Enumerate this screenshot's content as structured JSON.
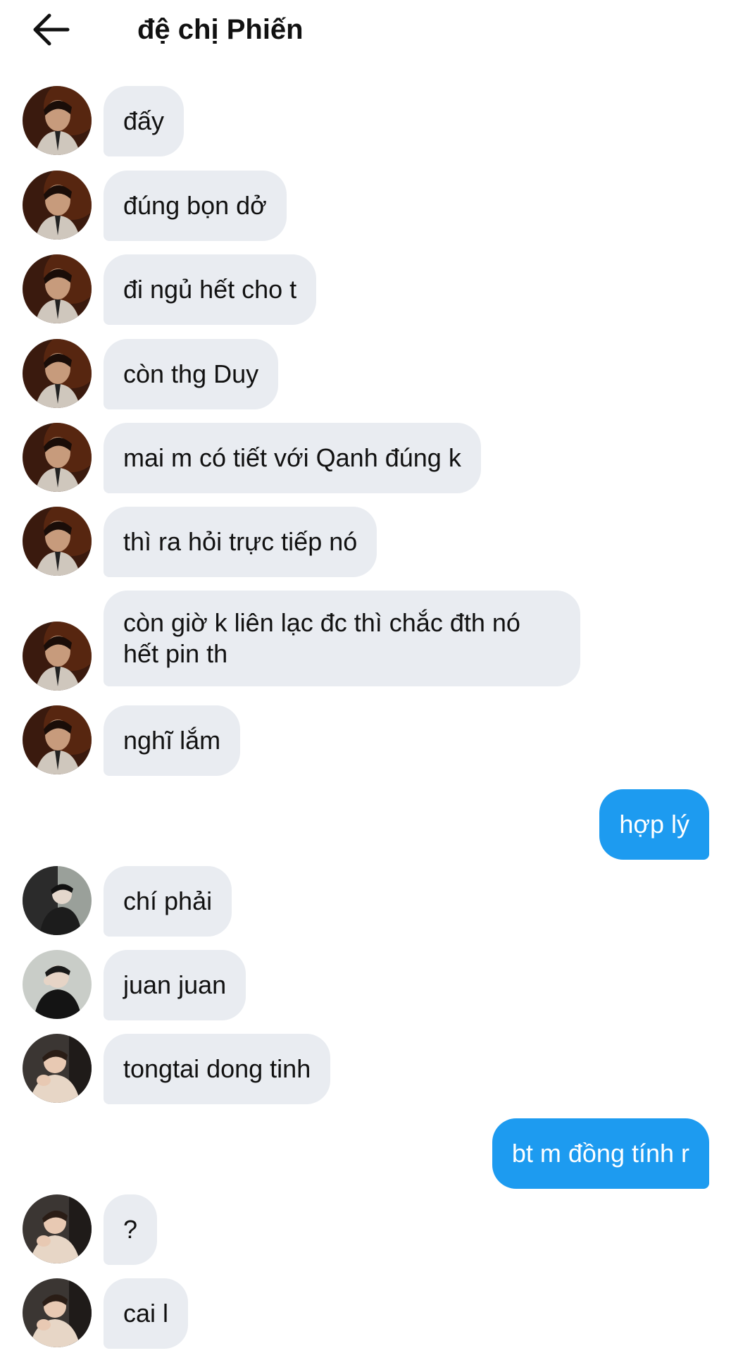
{
  "header": {
    "title": "đệ chị Phiến",
    "back_icon": "arrow-left-icon"
  },
  "colors": {
    "incoming_bubble": "#e9ecf1",
    "outgoing_bubble": "#1d9bf0",
    "background": "#ffffff"
  },
  "messages": [
    {
      "direction": "incoming",
      "avatar": "avatar-dark-portrait",
      "text": "đấy"
    },
    {
      "direction": "incoming",
      "avatar": "avatar-dark-portrait",
      "text": "đúng bọn dở"
    },
    {
      "direction": "incoming",
      "avatar": "avatar-dark-portrait",
      "text": "đi ngủ hết cho t"
    },
    {
      "direction": "incoming",
      "avatar": "avatar-dark-portrait",
      "text": "còn thg Duy"
    },
    {
      "direction": "incoming",
      "avatar": "avatar-dark-portrait",
      "text": "mai m có tiết với Qanh đúng k"
    },
    {
      "direction": "incoming",
      "avatar": "avatar-dark-portrait",
      "text": "thì ra hỏi trực tiếp nó"
    },
    {
      "direction": "incoming",
      "avatar": "avatar-dark-portrait",
      "text": "còn giờ k liên lạc đc thì chắc đth nó hết pin th"
    },
    {
      "direction": "incoming",
      "avatar": "avatar-dark-portrait",
      "text": "nghĩ lắm"
    },
    {
      "direction": "outgoing",
      "text": "hợp lý"
    },
    {
      "direction": "incoming",
      "avatar": "avatar-black-white",
      "text": "chí phải"
    },
    {
      "direction": "incoming",
      "avatar": "avatar-black-jacket",
      "text": "juan juan"
    },
    {
      "direction": "incoming",
      "avatar": "avatar-beige-portrait",
      "text": "tongtai dong tinh"
    },
    {
      "direction": "outgoing",
      "text": "bt m đồng tính r"
    },
    {
      "direction": "incoming",
      "avatar": "avatar-beige-portrait",
      "text": "?"
    },
    {
      "direction": "incoming",
      "avatar": "avatar-beige-portrait",
      "text": "cai l"
    }
  ]
}
